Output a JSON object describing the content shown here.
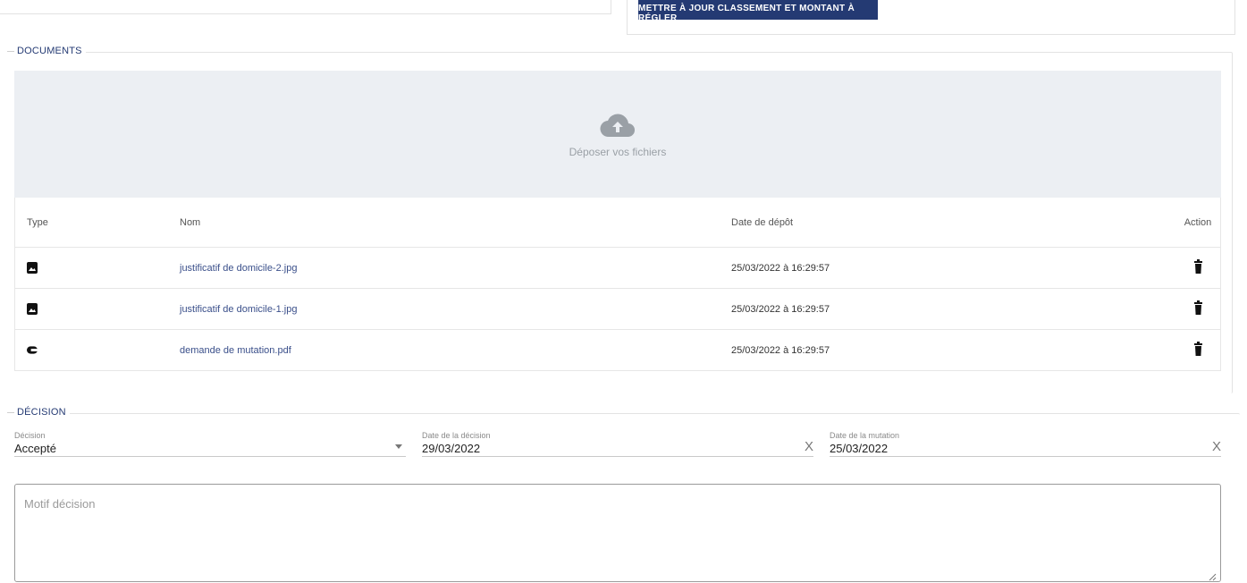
{
  "top": {
    "button_label": "METTRE À JOUR CLASSEMENT ET MONTANT À RÉGLER"
  },
  "documents": {
    "legend": "DOCUMENTS",
    "dropzone_text": "Déposer vos fichiers",
    "dropzone_icon": "cloud-upload-icon",
    "columns": {
      "type": "Type",
      "name": "Nom",
      "date": "Date de dépôt",
      "action": "Action"
    },
    "rows": [
      {
        "icon": "image-file-icon",
        "name": "justificatif de domicile-2.jpg",
        "date": "25/03/2022 à 16:29:57"
      },
      {
        "icon": "image-file-icon",
        "name": "justificatif de domicile-1.jpg",
        "date": "25/03/2022 à 16:29:57"
      },
      {
        "icon": "pdf-file-icon",
        "name": "demande de mutation.pdf",
        "date": "25/03/2022 à 16:29:57"
      }
    ]
  },
  "decision": {
    "legend": "DÉCISION",
    "decision_field": {
      "label": "Décision",
      "value": "Accepté"
    },
    "decision_date": {
      "label": "Date de la décision",
      "value": "29/03/2022",
      "clear": "X"
    },
    "mutation_date": {
      "label": "Date de la mutation",
      "value": "25/03/2022",
      "clear": "X"
    },
    "motif_placeholder": "Motif décision"
  },
  "colors": {
    "primary": "#243a73",
    "link": "#3a4f8a",
    "legend": "#243a73",
    "dropzone_bg": "#eceff3"
  }
}
